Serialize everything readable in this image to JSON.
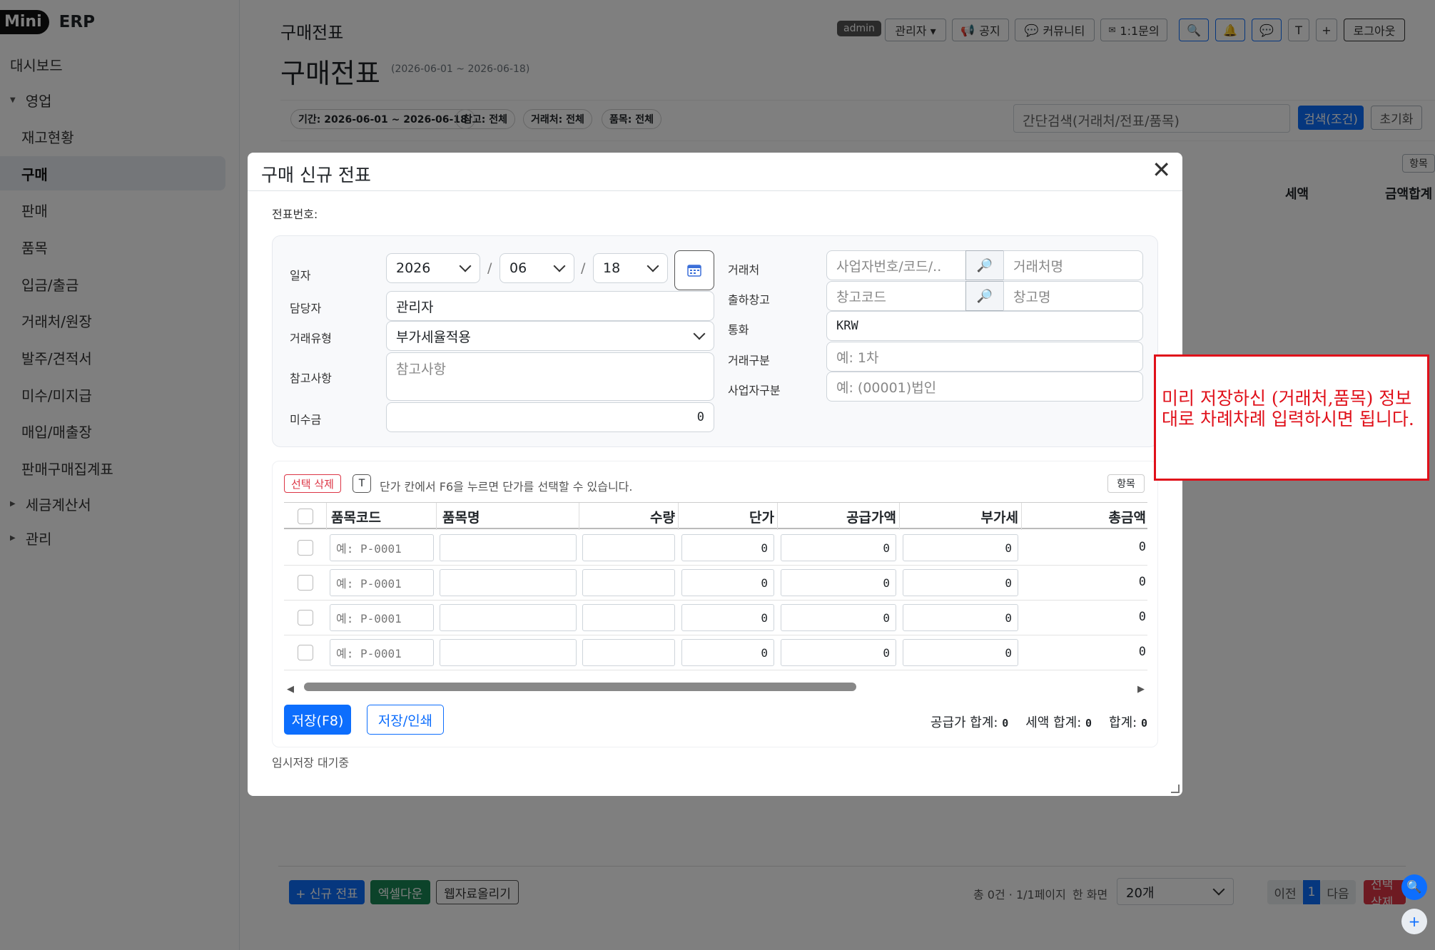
{
  "brand": {
    "mini": "Mini",
    "erp": "ERP"
  },
  "sidebar": {
    "items": [
      {
        "label": "대시보드"
      },
      {
        "label": "영업"
      },
      {
        "label": "재고현황"
      },
      {
        "label": "구매"
      },
      {
        "label": "판매"
      },
      {
        "label": "품목"
      },
      {
        "label": "입금/출금"
      },
      {
        "label": "거래처/원장"
      },
      {
        "label": "발주/견적서"
      },
      {
        "label": "미수/미지급"
      },
      {
        "label": "매입/매출장"
      },
      {
        "label": "판매구매집계표"
      },
      {
        "label": "세금계산서"
      },
      {
        "label": "관리"
      }
    ]
  },
  "topbar": {
    "title": "구매전표",
    "badge": "admin",
    "user_menu": "관리자 ▾",
    "notice": "공지",
    "community": "커뮤니티",
    "inquiry": "1:1문의",
    "t_button": "T",
    "plus_button": "+",
    "logout": "로그아웃"
  },
  "page": {
    "title": "구매전표",
    "period": "(2026-06-01 ~ 2026-06-18)",
    "chips": [
      "기간: 2026-06-01 ~ 2026-06-18",
      "참고: 전체",
      "거래처: 전체",
      "품목: 전체"
    ],
    "simple_search_placeholder": "간단검색(거래처/전표/품목)",
    "search_button": "검색(조건)",
    "reset_button": "초기화",
    "columns_button": "항목",
    "bg_headers": [
      "세액",
      "금액합계"
    ]
  },
  "bottom": {
    "new_voucher": "+ 신규 전표",
    "excel_down": "엑셀다운",
    "web_upload": "웹자료올리기",
    "summary": "총 0건 · 1/1페이지",
    "per_page_label": "한 화면",
    "per_page_value": "20개",
    "prev": "이전",
    "page": "1",
    "next": "다음",
    "select_delete": "선택 삭제"
  },
  "modal": {
    "title": "구매 신규 전표",
    "voucher_no_label": "전표번호:",
    "form": {
      "date_label": "일자",
      "year": "2026",
      "month": "06",
      "day": "18",
      "slash": "/",
      "manager_label": "담당자",
      "manager_value": "관리자",
      "trade_type_label": "거래유형",
      "trade_type_value": "부가세율적용",
      "memo_label": "참고사항",
      "memo_placeholder": "참고사항",
      "receivable_label": "미수금",
      "receivable_value": "0",
      "client_label": "거래처",
      "client_code_placeholder": "사업자번호/코드/..",
      "client_name_placeholder": "거래처명",
      "warehouse_label": "출하창고",
      "warehouse_code_placeholder": "창고코드",
      "warehouse_name_placeholder": "창고명",
      "currency_label": "통화",
      "currency_value": "KRW",
      "trade_div_label": "거래구분",
      "trade_div_placeholder": "예: 1차",
      "biz_div_label": "사업자구분",
      "biz_div_placeholder": "예: (00001)법인"
    },
    "grid": {
      "delete_selected": "선택 삭제",
      "t_key": "T",
      "hint": "단가 칸에서 F6을 누르면 단가를 선택할 수 있습니다.",
      "columns_button": "항목",
      "headers": [
        "품목코드",
        "품목명",
        "수량",
        "단가",
        "공급가액",
        "부가세",
        "총금액"
      ],
      "rows": [
        {
          "code_placeholder": "예: P-0001",
          "unit_price": "0",
          "supply": "0",
          "vat": "0",
          "total": "0"
        },
        {
          "code_placeholder": "예: P-0001",
          "unit_price": "0",
          "supply": "0",
          "vat": "0",
          "total": "0"
        },
        {
          "code_placeholder": "예: P-0001",
          "unit_price": "0",
          "supply": "0",
          "vat": "0",
          "total": "0"
        },
        {
          "code_placeholder": "예: P-0001",
          "unit_price": "0",
          "supply": "0",
          "vat": "0",
          "total": "0"
        }
      ],
      "save_button": "저장(F8)",
      "save_print_button": "저장/인쇄",
      "supply_total_label": "공급가 합계:",
      "supply_total": "0",
      "tax_total_label": "세액 합계:",
      "tax_total": "0",
      "grand_total_label": "합계:",
      "grand_total": "0"
    },
    "autosave_status": "임시저장 대기중"
  },
  "annotation": {
    "text": "미리 저장하신 (거래처,품목) 정보대로 차례차례 입력하시면 됩니다."
  },
  "colors": {
    "primary": "#0d6efd",
    "success": "#198754",
    "danger": "#dc3545",
    "annotation": "#e0101a"
  }
}
